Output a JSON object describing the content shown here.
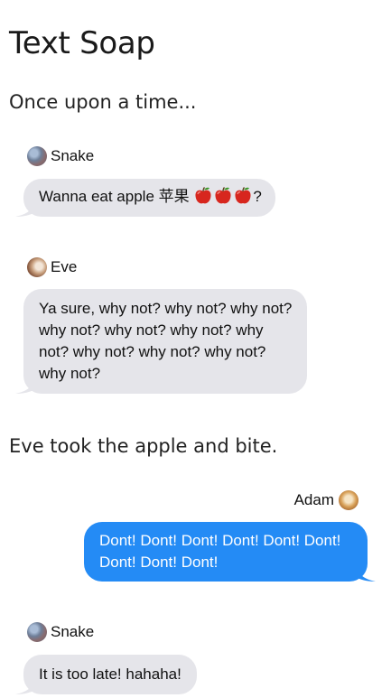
{
  "page": {
    "title": "Text Soap"
  },
  "story": [
    "Once upon a time...",
    "Eve took the apple and bite."
  ],
  "messages": [
    {
      "sender": "Snake",
      "avatar": "snake-avatar",
      "side": "left",
      "text_before": "Wanna eat apple 苹果 ",
      "emoji": [
        "🍎",
        "🍎",
        "🍎"
      ],
      "text_after": "?"
    },
    {
      "sender": "Eve",
      "avatar": "eve-avatar",
      "side": "left",
      "text": "Ya sure, why not? why not? why not? why not? why not? why not? why not? why not? why not? why not? why not?"
    },
    {
      "sender": "Adam",
      "avatar": "adam-avatar",
      "side": "right",
      "text": "Dont! Dont! Dont! Dont! Dont! Dont! Dont! Dont! Dont!"
    },
    {
      "sender": "Snake",
      "avatar": "snake-avatar",
      "side": "left",
      "text": "It is too late! hahaha!"
    }
  ],
  "colors": {
    "incoming_bubble": "#e5e5ea",
    "outgoing_bubble": "#248bf5",
    "outgoing_text": "#ffffff"
  }
}
